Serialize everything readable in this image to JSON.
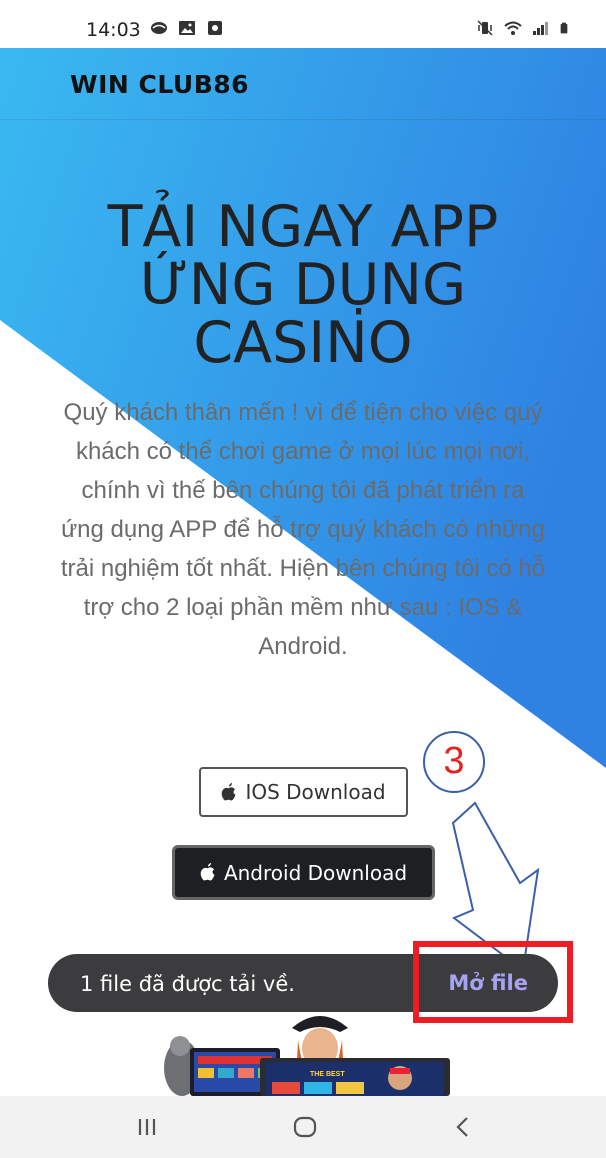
{
  "status_bar": {
    "time": "14:03",
    "left_icons": [
      "message-icon",
      "gallery-icon",
      "app-notification-icon"
    ],
    "right_icons": [
      "mute-vibrate-icon",
      "wifi-icon",
      "signal-icon",
      "battery-icon"
    ]
  },
  "header": {
    "brand": "WIN CLUB86"
  },
  "hero": {
    "title_lines": [
      "TẢI NGAY APP",
      "ỨNG DỤNG",
      "CASINO"
    ],
    "description": "Quý khách thân mến ! vì để tiện cho việc quý khách có thể chơi game ở mọi lúc mọi nơi, chính vì thế bên chúng tôi đã phát triển ra ứng dụng APP để hỗ trợ quý khách có những trải nghiệm tốt nhất. Hiện bên chúng tôi có hỗ trợ cho 2 loại phần mềm như sau : IOS & Android."
  },
  "buttons": {
    "ios": "IOS Download",
    "android": "Android Download"
  },
  "annotation": {
    "step": "3"
  },
  "snackbar": {
    "message": "1 file đã được tải về.",
    "action": "Mở file"
  },
  "navigation": {
    "buttons": [
      "recent-apps-icon",
      "home-icon",
      "back-icon"
    ]
  },
  "colors": {
    "gradient_start": "#39b8f0",
    "gradient_end": "#2f80e0",
    "snackbar": "#3c3c3e",
    "snackbar_action": "#a7a3f3",
    "highlight": "#ee1c24",
    "step_number": "#e2261f"
  }
}
